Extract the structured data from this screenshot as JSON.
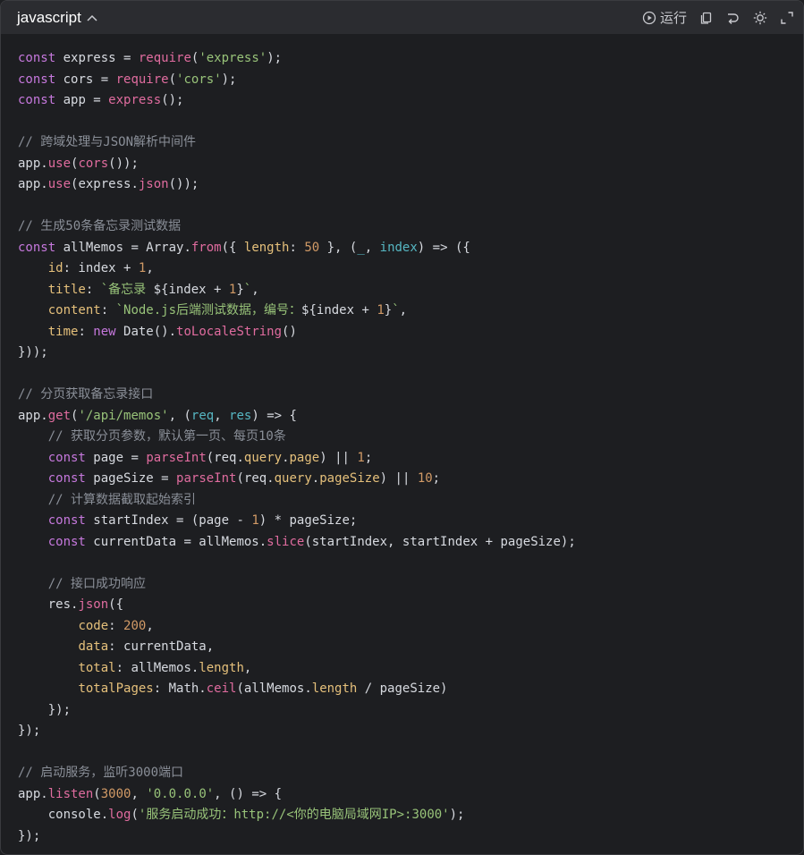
{
  "header": {
    "language": "javascript",
    "run_label": "运行"
  },
  "icons": [
    "chevron-up-icon",
    "play-circle-icon",
    "copy-icon",
    "wrap-icon",
    "theme-icon",
    "expand-icon"
  ],
  "code_lines": [
    [
      [
        "kw",
        "const"
      ],
      [
        "pl",
        " express = "
      ],
      [
        "fn",
        "require"
      ],
      [
        "pl",
        "("
      ],
      [
        "str",
        "'express'"
      ],
      [
        "pl",
        ");"
      ]
    ],
    [
      [
        "kw",
        "const"
      ],
      [
        "pl",
        " cors = "
      ],
      [
        "fn",
        "require"
      ],
      [
        "pl",
        "("
      ],
      [
        "str",
        "'cors'"
      ],
      [
        "pl",
        ");"
      ]
    ],
    [
      [
        "kw",
        "const"
      ],
      [
        "pl",
        " app = "
      ],
      [
        "fn",
        "express"
      ],
      [
        "pl",
        "();"
      ]
    ],
    [],
    [
      [
        "cm",
        "// 跨域处理与JSON解析中间件"
      ]
    ],
    [
      [
        "pl",
        "app."
      ],
      [
        "fn",
        "use"
      ],
      [
        "pl",
        "("
      ],
      [
        "fn",
        "cors"
      ],
      [
        "pl",
        "());"
      ]
    ],
    [
      [
        "pl",
        "app."
      ],
      [
        "fn",
        "use"
      ],
      [
        "pl",
        "(express."
      ],
      [
        "fn",
        "json"
      ],
      [
        "pl",
        "());"
      ]
    ],
    [],
    [
      [
        "cm",
        "// 生成50条备忘录测试数据"
      ]
    ],
    [
      [
        "kw",
        "const"
      ],
      [
        "pl",
        " allMemos = Array."
      ],
      [
        "fn",
        "from"
      ],
      [
        "pl",
        "({ "
      ],
      [
        "prop",
        "length"
      ],
      [
        "pl",
        ": "
      ],
      [
        "num",
        "50"
      ],
      [
        "pl",
        " }, ("
      ],
      [
        "param",
        "_"
      ],
      [
        "pl",
        ", "
      ],
      [
        "param",
        "index"
      ],
      [
        "pl",
        ") => ({"
      ]
    ],
    [
      [
        "pl",
        "    "
      ],
      [
        "prop",
        "id"
      ],
      [
        "pl",
        ": index + "
      ],
      [
        "num",
        "1"
      ],
      [
        "pl",
        ","
      ]
    ],
    [
      [
        "pl",
        "    "
      ],
      [
        "prop",
        "title"
      ],
      [
        "pl",
        ": "
      ],
      [
        "str",
        "`备忘录 "
      ],
      [
        "pl",
        "${index + "
      ],
      [
        "num",
        "1"
      ],
      [
        "pl",
        "}"
      ],
      [
        "str",
        "`"
      ],
      [
        "pl",
        ","
      ]
    ],
    [
      [
        "pl",
        "    "
      ],
      [
        "prop",
        "content"
      ],
      [
        "pl",
        ": "
      ],
      [
        "str",
        "`Node.js后端测试数据，编号："
      ],
      [
        "pl",
        "${index + "
      ],
      [
        "num",
        "1"
      ],
      [
        "pl",
        "}"
      ],
      [
        "str",
        "`"
      ],
      [
        "pl",
        ","
      ]
    ],
    [
      [
        "pl",
        "    "
      ],
      [
        "prop",
        "time"
      ],
      [
        "pl",
        ": "
      ],
      [
        "kw",
        "new"
      ],
      [
        "pl",
        " Date()."
      ],
      [
        "fn",
        "toLocaleString"
      ],
      [
        "pl",
        "()"
      ]
    ],
    [
      [
        "pl",
        "}));"
      ]
    ],
    [],
    [
      [
        "cm",
        "// 分页获取备忘录接口"
      ]
    ],
    [
      [
        "pl",
        "app."
      ],
      [
        "fn",
        "get"
      ],
      [
        "pl",
        "("
      ],
      [
        "str",
        "'/api/memos'"
      ],
      [
        "pl",
        ", ("
      ],
      [
        "param",
        "req"
      ],
      [
        "pl",
        ", "
      ],
      [
        "param",
        "res"
      ],
      [
        "pl",
        ") => {"
      ]
    ],
    [
      [
        "pl",
        "    "
      ],
      [
        "cm",
        "// 获取分页参数，默认第一页、每页10条"
      ]
    ],
    [
      [
        "pl",
        "    "
      ],
      [
        "kw",
        "const"
      ],
      [
        "pl",
        " page = "
      ],
      [
        "fn",
        "parseInt"
      ],
      [
        "pl",
        "(req."
      ],
      [
        "prop",
        "query"
      ],
      [
        "pl",
        "."
      ],
      [
        "prop",
        "page"
      ],
      [
        "pl",
        ") || "
      ],
      [
        "num",
        "1"
      ],
      [
        "pl",
        ";"
      ]
    ],
    [
      [
        "pl",
        "    "
      ],
      [
        "kw",
        "const"
      ],
      [
        "pl",
        " pageSize = "
      ],
      [
        "fn",
        "parseInt"
      ],
      [
        "pl",
        "(req."
      ],
      [
        "prop",
        "query"
      ],
      [
        "pl",
        "."
      ],
      [
        "prop",
        "pageSize"
      ],
      [
        "pl",
        ") || "
      ],
      [
        "num",
        "10"
      ],
      [
        "pl",
        ";"
      ]
    ],
    [
      [
        "pl",
        "    "
      ],
      [
        "cm",
        "// 计算数据截取起始索引"
      ]
    ],
    [
      [
        "pl",
        "    "
      ],
      [
        "kw",
        "const"
      ],
      [
        "pl",
        " startIndex = (page - "
      ],
      [
        "num",
        "1"
      ],
      [
        "pl",
        ") * pageSize;"
      ]
    ],
    [
      [
        "pl",
        "    "
      ],
      [
        "kw",
        "const"
      ],
      [
        "pl",
        " currentData = allMemos."
      ],
      [
        "fn",
        "slice"
      ],
      [
        "pl",
        "(startIndex, startIndex + pageSize);"
      ]
    ],
    [],
    [
      [
        "pl",
        "    "
      ],
      [
        "cm",
        "// 接口成功响应"
      ]
    ],
    [
      [
        "pl",
        "    res."
      ],
      [
        "fn",
        "json"
      ],
      [
        "pl",
        "({"
      ]
    ],
    [
      [
        "pl",
        "        "
      ],
      [
        "prop",
        "code"
      ],
      [
        "pl",
        ": "
      ],
      [
        "num",
        "200"
      ],
      [
        "pl",
        ","
      ]
    ],
    [
      [
        "pl",
        "        "
      ],
      [
        "prop",
        "data"
      ],
      [
        "pl",
        ": currentData,"
      ]
    ],
    [
      [
        "pl",
        "        "
      ],
      [
        "prop",
        "total"
      ],
      [
        "pl",
        ": allMemos."
      ],
      [
        "prop",
        "length"
      ],
      [
        "pl",
        ","
      ]
    ],
    [
      [
        "pl",
        "        "
      ],
      [
        "prop",
        "totalPages"
      ],
      [
        "pl",
        ": Math."
      ],
      [
        "fn",
        "ceil"
      ],
      [
        "pl",
        "(allMemos."
      ],
      [
        "prop",
        "length"
      ],
      [
        "pl",
        " / pageSize)"
      ]
    ],
    [
      [
        "pl",
        "    });"
      ]
    ],
    [
      [
        "pl",
        "});"
      ]
    ],
    [],
    [
      [
        "cm",
        "// 启动服务，监听3000端口"
      ]
    ],
    [
      [
        "pl",
        "app."
      ],
      [
        "fn",
        "listen"
      ],
      [
        "pl",
        "("
      ],
      [
        "num",
        "3000"
      ],
      [
        "pl",
        ", "
      ],
      [
        "str",
        "'0.0.0.0'"
      ],
      [
        "pl",
        ", () => {"
      ]
    ],
    [
      [
        "pl",
        "    console."
      ],
      [
        "fn",
        "log"
      ],
      [
        "pl",
        "("
      ],
      [
        "str",
        "'服务启动成功：http://<你的电脑局域网IP>:3000'"
      ],
      [
        "pl",
        ");"
      ]
    ],
    [
      [
        "pl",
        "});"
      ]
    ]
  ]
}
